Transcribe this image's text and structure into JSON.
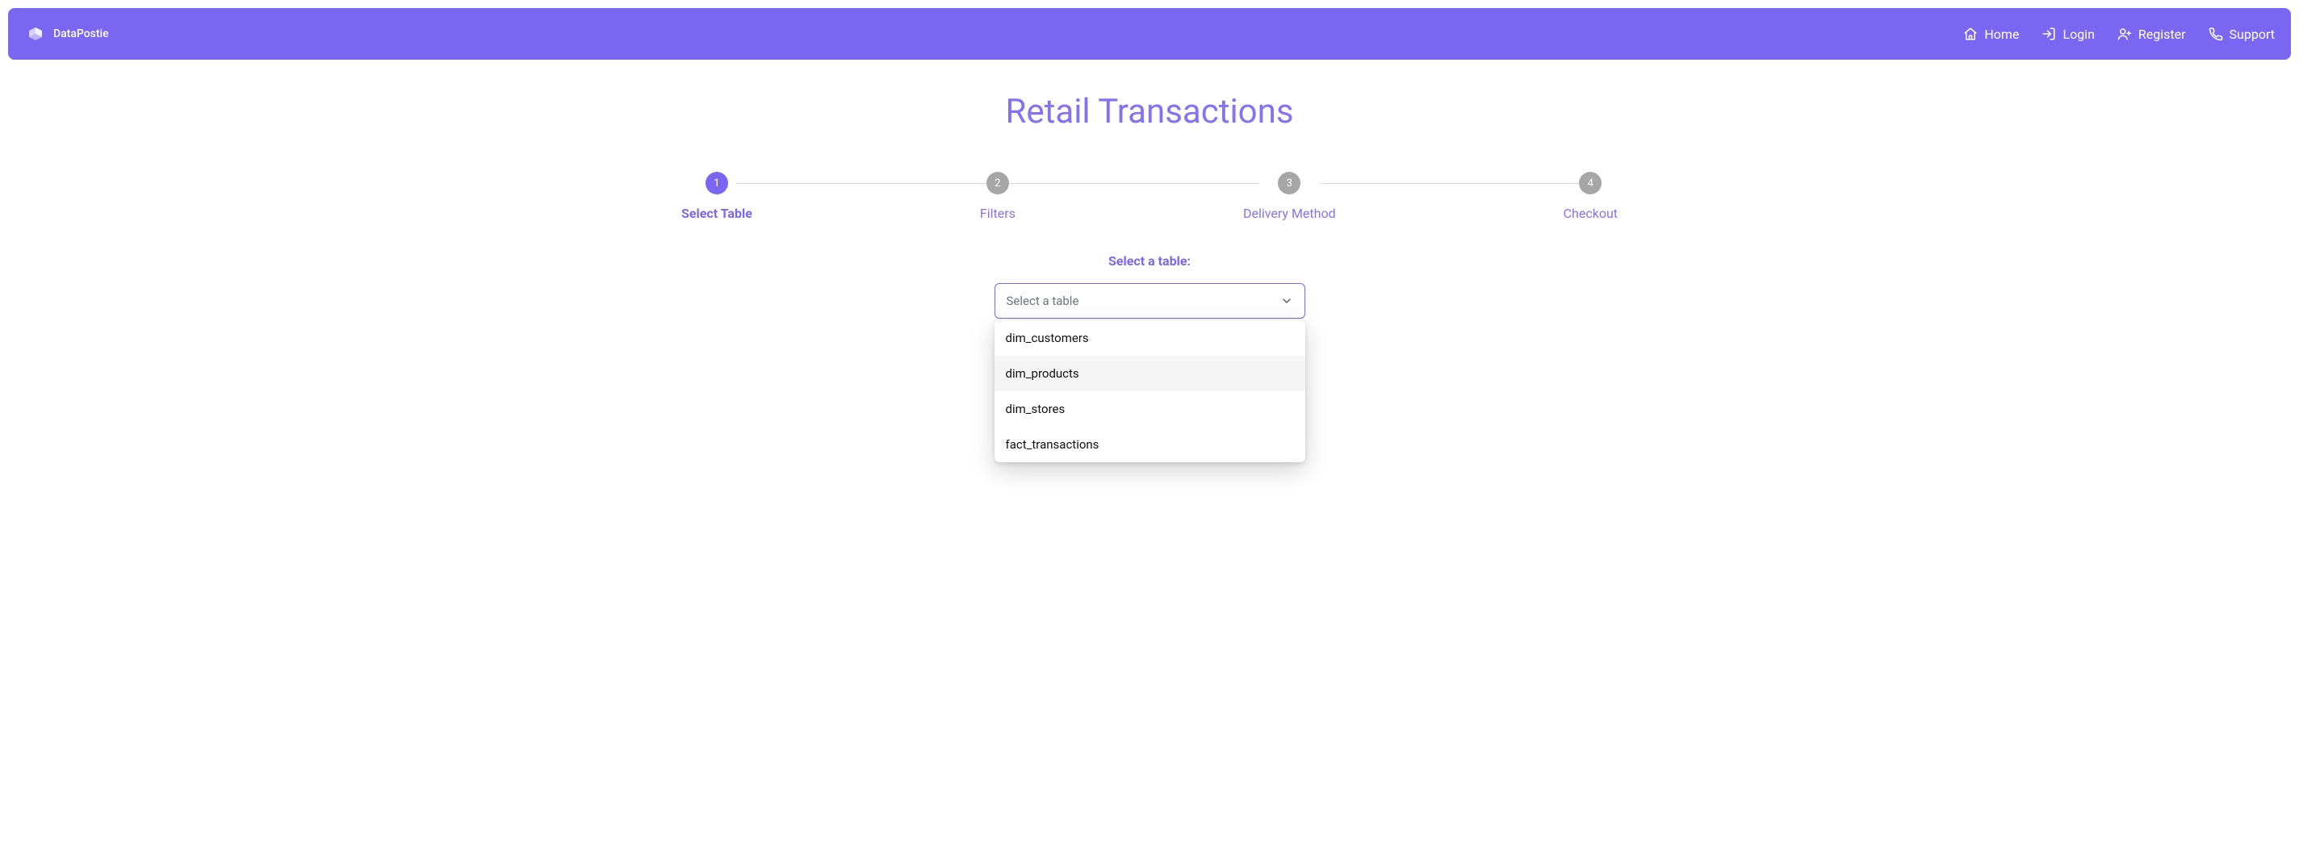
{
  "brand": {
    "name": "DataPostie"
  },
  "nav": {
    "home": "Home",
    "login": "Login",
    "register": "Register",
    "support": "Support"
  },
  "page": {
    "title": "Retail Transactions"
  },
  "steps": [
    {
      "num": "1",
      "label": "Select Table",
      "active": true
    },
    {
      "num": "2",
      "label": "Filters",
      "active": false
    },
    {
      "num": "3",
      "label": "Delivery Method",
      "active": false
    },
    {
      "num": "4",
      "label": "Checkout",
      "active": false
    }
  ],
  "form": {
    "label": "Select a table:",
    "placeholder": "Select a table",
    "options": [
      "dim_customers",
      "dim_products",
      "dim_stores",
      "fact_transactions"
    ],
    "hover_index": 1
  }
}
